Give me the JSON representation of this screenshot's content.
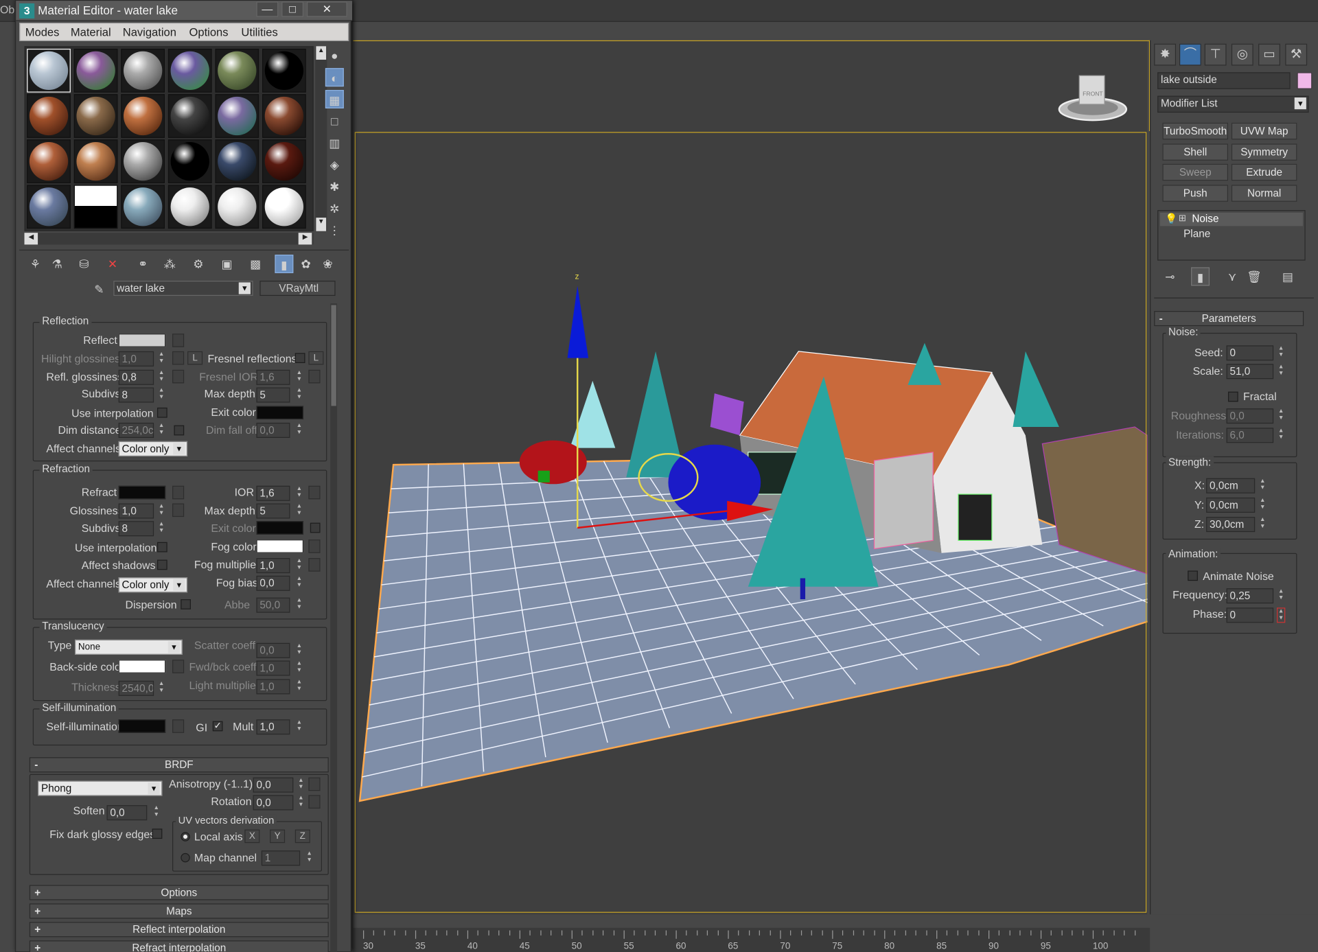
{
  "window": {
    "frag": "Ob",
    "title": "Material Editor - water lake",
    "min": "—",
    "max": "□",
    "close": "✕"
  },
  "menu": [
    "Modes",
    "Material",
    "Navigation",
    "Options",
    "Utilities"
  ],
  "material": {
    "name": "water lake",
    "type": "VRayMtl"
  },
  "reflection": {
    "title": "Reflection",
    "reflect": "Reflect",
    "hilight": "Hilight glossiness",
    "hilight_v": "1,0",
    "L": "L",
    "fresnel": "Fresnel reflections",
    "refl_gloss": "Refl. glossiness",
    "refl_gloss_v": "0,8",
    "fresnel_ior": "Fresnel IOR",
    "fresnel_ior_v": "1,6",
    "subdivs": "Subdivs",
    "subdivs_v": "8",
    "max_depth": "Max depth",
    "max_depth_v": "5",
    "use_interp": "Use interpolation",
    "exit_color": "Exit color",
    "dim_dist": "Dim distance",
    "dim_dist_v": "254,0c",
    "dim_falloff": "Dim fall off",
    "dim_falloff_v": "0,0",
    "affect": "Affect channels",
    "affect_v": "Color only"
  },
  "refraction": {
    "title": "Refraction",
    "refract": "Refract",
    "ior": "IOR",
    "ior_v": "1,6",
    "gloss": "Glossiness",
    "gloss_v": "1,0",
    "max_depth": "Max depth",
    "max_depth_v": "5",
    "subdivs": "Subdivs",
    "subdivs_v": "8",
    "exit_color": "Exit color",
    "use_interp": "Use interpolation",
    "fog_color": "Fog color",
    "affect_shadows": "Affect shadows",
    "fog_mult": "Fog multiplier",
    "fog_mult_v": "1,0",
    "affect": "Affect channels",
    "affect_v": "Color only",
    "fog_bias": "Fog bias",
    "fog_bias_v": "0,0",
    "dispersion": "Dispersion",
    "abbe": "Abbe",
    "abbe_v": "50,0"
  },
  "translucency": {
    "title": "Translucency",
    "type": "Type",
    "type_v": "None",
    "scatter": "Scatter coeff",
    "scatter_v": "0,0",
    "back": "Back-side color",
    "fwd": "Fwd/bck coeff",
    "fwd_v": "1,0",
    "thickness": "Thickness",
    "thickness_v": "2540,0",
    "light": "Light multiplier",
    "light_v": "1,0"
  },
  "selfillum": {
    "title": "Self-illumination",
    "label": "Self-illumination",
    "gi": "GI",
    "mult": "Mult",
    "mult_v": "1,0"
  },
  "brdf": {
    "title": "BRDF",
    "pm": "-",
    "type_v": "Phong",
    "aniso": "Anisotropy (-1..1)",
    "aniso_v": "0,0",
    "rotation": "Rotation",
    "rotation_v": "0,0",
    "soften": "Soften",
    "soften_v": "0,0",
    "uvtitle": "UV vectors derivation",
    "fixdark": "Fix dark glossy edges",
    "local": "Local axis",
    "x": "X",
    "y": "Y",
    "z": "Z",
    "mapch": "Map channel",
    "mapch_v": "1"
  },
  "rollups": [
    {
      "pm": "+",
      "label": "Options"
    },
    {
      "pm": "+",
      "label": "Maps"
    },
    {
      "pm": "+",
      "label": "Reflect interpolation"
    },
    {
      "pm": "+",
      "label": "Refract interpolation"
    }
  ],
  "cmd": {
    "object_name": "lake outside",
    "modlist": "Modifier List",
    "mods": [
      "TurboSmooth",
      "UVW Map",
      "Shell",
      "Symmetry",
      "Sweep",
      "Extrude",
      "Push",
      "Normal"
    ],
    "stack": [
      "Noise",
      "Plane"
    ],
    "params_title": "Parameters",
    "params_pm": "-",
    "noise": "Noise:",
    "seed": "Seed:",
    "seed_v": "0",
    "scale": "Scale:",
    "scale_v": "51,0",
    "fractal": "Fractal",
    "rough": "Roughness:",
    "rough_v": "0,0",
    "iter": "Iterations:",
    "iter_v": "6,0",
    "strength": "Strength:",
    "x": "X:",
    "x_v": "0,0cm",
    "y": "Y:",
    "y_v": "0,0cm",
    "z": "Z:",
    "z_v": "30,0cm",
    "anim": "Animation:",
    "anim_noise": "Animate Noise",
    "freq": "Frequency:",
    "freq_v": "0,25",
    "phase": "Phase:",
    "phase_v": "0"
  },
  "viewport": {
    "gizmo_z": "z",
    "cube_label": "FRONT"
  },
  "timeline": [
    "30",
    "35",
    "40",
    "45",
    "50",
    "55",
    "60",
    "65",
    "70",
    "75",
    "80",
    "85",
    "90",
    "95",
    "100"
  ]
}
